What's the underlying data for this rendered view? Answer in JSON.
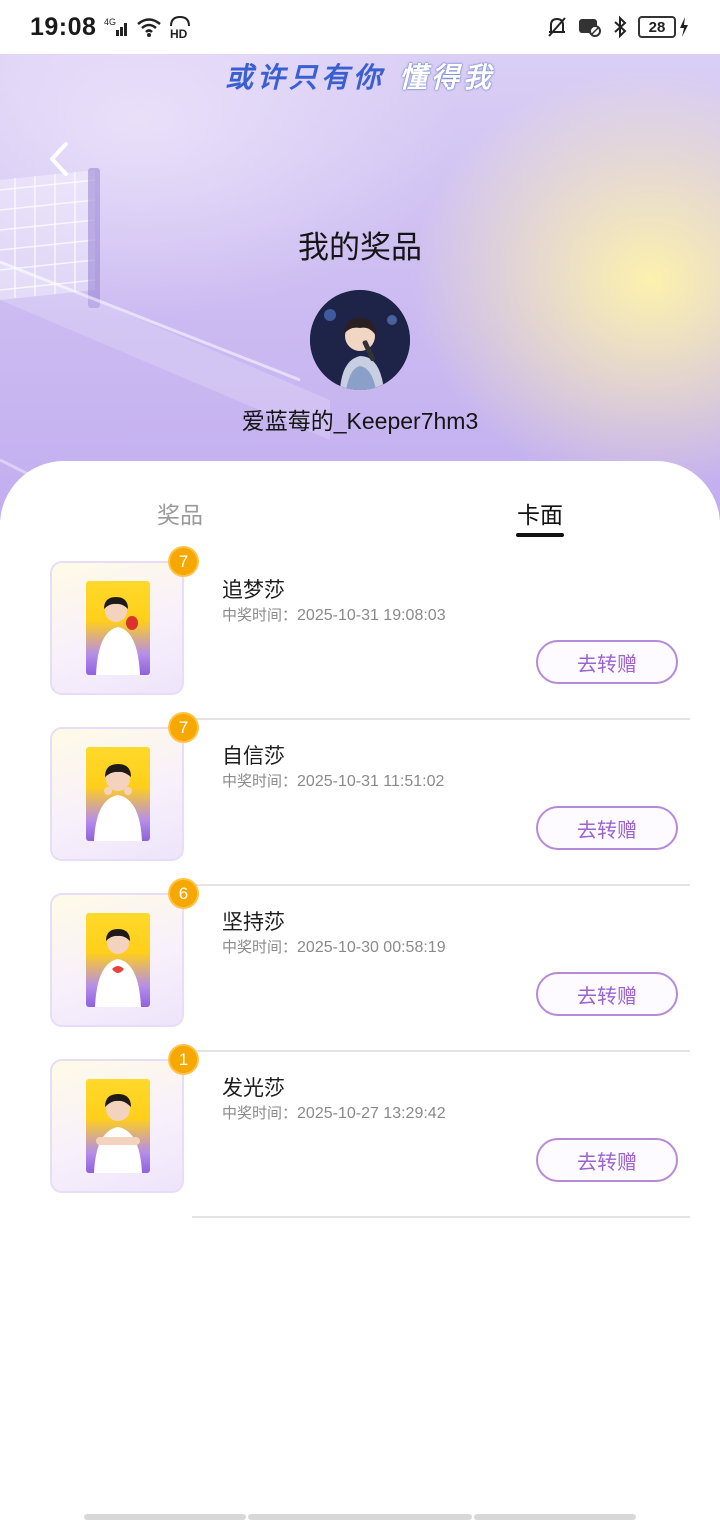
{
  "status_bar": {
    "time": "19:08",
    "network": "4G",
    "hd_label": "HD",
    "battery": "28"
  },
  "banner": {
    "part1": "或许只有你",
    "part2": "懂得我"
  },
  "header": {
    "title": "我的奖品",
    "username": "爱蓝莓的_Keeper7hm3"
  },
  "tabs": [
    {
      "label": "奖品",
      "active": false
    },
    {
      "label": "卡面",
      "active": true
    }
  ],
  "time_prefix": "中奖时间：",
  "items": [
    {
      "name": "追梦莎",
      "count": "7",
      "time": "2025-10-31 19:08:03",
      "button": "去转赠",
      "card_caption": "追梦莎"
    },
    {
      "name": "自信莎",
      "count": "7",
      "time": "2025-10-31 11:51:02",
      "button": "去转赠",
      "card_caption": "自信莎"
    },
    {
      "name": "坚持莎",
      "count": "6",
      "time": "2025-10-30 00:58:19",
      "button": "去转赠",
      "card_caption": "坚持莎"
    },
    {
      "name": "发光莎",
      "count": "1",
      "time": "2025-10-27 13:29:42",
      "button": "去转赠",
      "card_caption": "发光莎"
    }
  ],
  "colors": {
    "accent_purple": "#9a63cf",
    "badge_orange": "#f6a800",
    "hero_purple": "#c2aef0"
  }
}
